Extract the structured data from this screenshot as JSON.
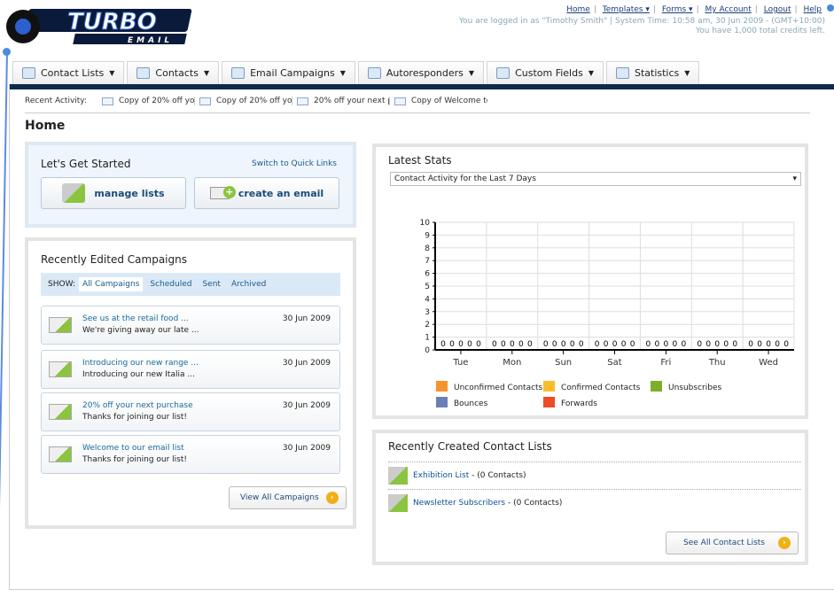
{
  "logo": {
    "text": "TURBO",
    "sub": "EMAIL"
  },
  "header": {
    "links": [
      "Home",
      "Templates",
      "Forms",
      "My Account",
      "Logout",
      "Help"
    ],
    "dropdown_links": [
      "Templates",
      "Forms"
    ],
    "login_info": "You are logged in as \"Timothy Smith\" | System Time: 10:58 am, 30 Jun 2009 - (GMT+10:00)",
    "credits": "You have 1,000 total credits left."
  },
  "nav": {
    "tabs": [
      {
        "label": "Contact Lists",
        "icon": "contact-lists-icon"
      },
      {
        "label": "Contacts",
        "icon": "contacts-icon"
      },
      {
        "label": "Email Campaigns",
        "icon": "envelope-icon"
      },
      {
        "label": "Autoresponders",
        "icon": "autoresponder-icon"
      },
      {
        "label": "Custom Fields",
        "icon": "custom-fields-icon"
      },
      {
        "label": "Statistics",
        "icon": "bar-chart-icon"
      }
    ],
    "accent": "#0e2a4f"
  },
  "recent_activity": {
    "label": "Recent Activity:",
    "items": [
      "Copy of 20% off yo",
      "Copy of 20% off yo",
      "20% off your next p",
      "Copy of Welcome to"
    ]
  },
  "page_title": "Home",
  "get_started": {
    "title": "Let's Get Started",
    "switch_link": "Switch to Quick Links",
    "manage_lists": "manage lists",
    "create_email": "create an email"
  },
  "campaigns": {
    "title": "Recently Edited Campaigns",
    "show_label": "SHOW:",
    "filters": [
      "All Campaigns",
      "Scheduled",
      "Sent",
      "Archived"
    ],
    "active_filter": "All Campaigns",
    "items": [
      {
        "title": "See us at the retail food ...",
        "snippet": "We're giving away our late ...",
        "date": "30 Jun 2009"
      },
      {
        "title": "Introducing our new range ...",
        "snippet": "Introducing our new Italia ...",
        "date": "30 Jun 2009"
      },
      {
        "title": "20% off your next purchase",
        "snippet": "Thanks for joining our list!",
        "date": "30 Jun 2009"
      },
      {
        "title": "Welcome to our email list",
        "snippet": "Thanks for joining our list!",
        "date": "30 Jun 2009"
      }
    ],
    "view_all": "View All Campaigns"
  },
  "stats": {
    "title": "Latest Stats",
    "selected": "Contact Activity for the Last 7 Days"
  },
  "chart_data": {
    "type": "bar",
    "categories": [
      "Tue",
      "Mon",
      "Sun",
      "Sat",
      "Fri",
      "Thu",
      "Wed"
    ],
    "ylim": [
      0,
      10
    ],
    "yticks": [
      0,
      1,
      2,
      3,
      4,
      5,
      6,
      7,
      8,
      9,
      10
    ],
    "grid": true,
    "legend_placement": "bottom",
    "series": [
      {
        "name": "Unconfirmed Contacts",
        "color": "#f7922e",
        "values": [
          0,
          0,
          0,
          0,
          0,
          0,
          0
        ]
      },
      {
        "name": "Confirmed Contacts",
        "color": "#f9bd2c",
        "values": [
          0,
          0,
          0,
          0,
          0,
          0,
          0
        ]
      },
      {
        "name": "Unsubscribes",
        "color": "#7fad2a",
        "values": [
          0,
          0,
          0,
          0,
          0,
          0,
          0
        ]
      },
      {
        "name": "Bounces",
        "color": "#6a80b4",
        "values": [
          0,
          0,
          0,
          0,
          0,
          0,
          0
        ]
      },
      {
        "name": "Forwards",
        "color": "#ee4b26",
        "values": [
          0,
          0,
          0,
          0,
          0,
          0,
          0
        ]
      }
    ]
  },
  "contact_lists": {
    "title": "Recently Created Contact Lists",
    "items": [
      {
        "name": "Exhibition List",
        "count": " - (0 Contacts)"
      },
      {
        "name": "Newsletter Subscribers",
        "count": " - (0 Contacts)"
      }
    ],
    "see_all": "See All Contact Lists"
  }
}
